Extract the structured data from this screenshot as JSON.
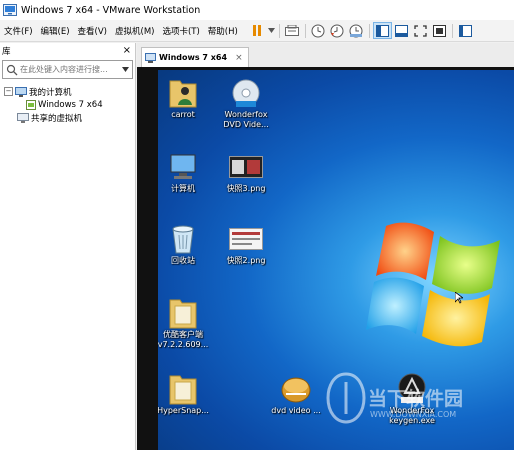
{
  "window": {
    "title": "Windows 7 x64 - VMware Workstation"
  },
  "menu": [
    "文件(F)",
    "编辑(E)",
    "查看(V)",
    "虚拟机(M)",
    "选项卡(T)",
    "帮助(H)"
  ],
  "sidebar": {
    "header": "库",
    "close": "×",
    "search_placeholder": "在此处键入内容进行搜...",
    "tree": [
      {
        "label": "我的计算机",
        "toggle": "−"
      },
      {
        "label": "Windows 7 x64"
      },
      {
        "label": "共享的虚拟机"
      }
    ]
  },
  "tab": {
    "label": "Windows 7 x64",
    "close": "×"
  },
  "desktop_icons": [
    {
      "label": "carrot",
      "icon": "folder-user-icon"
    },
    {
      "label": "Wonderfox\nDVD Vide...",
      "icon": "dvd-ripper-icon"
    },
    {
      "label": "计算机",
      "icon": "computer-icon"
    },
    {
      "label": "快照3.png",
      "icon": "image-file-icon"
    },
    {
      "label": "回收站",
      "icon": "recycle-bin-icon"
    },
    {
      "label": "快照2.png",
      "icon": "image-file-icon"
    },
    {
      "label": "优酷客户端\nv7.2.2.609...",
      "icon": "folder-icon"
    },
    {
      "label": "HyperSnap...",
      "icon": "folder-icon"
    },
    {
      "label": "dvd video ...",
      "icon": "dvd-icon"
    },
    {
      "label": "WonderFox\nkeygen.exe",
      "icon": "keygen-icon"
    }
  ],
  "watermark": {
    "text": "当下软件园",
    "sub": "WWW.DOWNXIA.COM"
  },
  "colors": {
    "accent": "#1267c7",
    "selection": "#cce4f7"
  }
}
